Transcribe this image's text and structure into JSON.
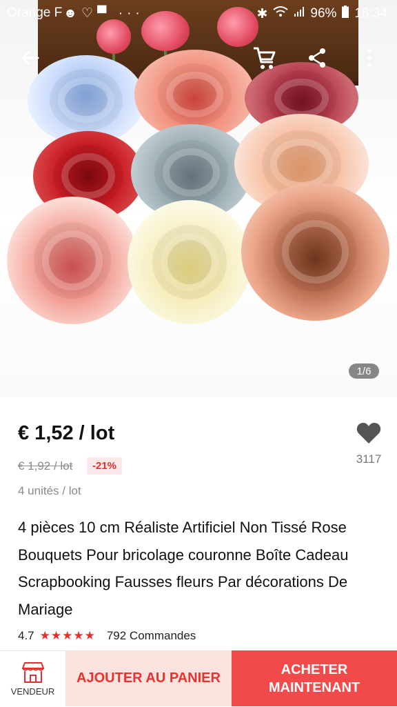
{
  "status_bar": {
    "carrier": "Orange F",
    "battery": "96%",
    "time": "18:34"
  },
  "gallery": {
    "counter": "1/6"
  },
  "product": {
    "price": "€ 1,52 / lot",
    "old_price": "€ 1,92 / lot",
    "discount": "-21%",
    "units": "4 unités / lot",
    "wishlist_count": "3117",
    "title": "4 pièces 10 cm Réaliste Artificiel Non Tissé Rose Bouquets Pour bricolage couronne Boîte Cadeau Scrapbooking Fausses fleurs Par décorations De Mariage",
    "rating": "4.7",
    "stars_filled": 5,
    "orders": "792 Commandes"
  },
  "actions": {
    "vendor_label": "VENDEUR",
    "add_to_cart": "AJOUTER AU PANIER",
    "buy_now": "ACHETER\nMAINTENANT"
  },
  "colors": {
    "accent_red": "#e62e2e",
    "buy_button": "#f24a4a",
    "cart_button_bg": "#fde3df"
  }
}
